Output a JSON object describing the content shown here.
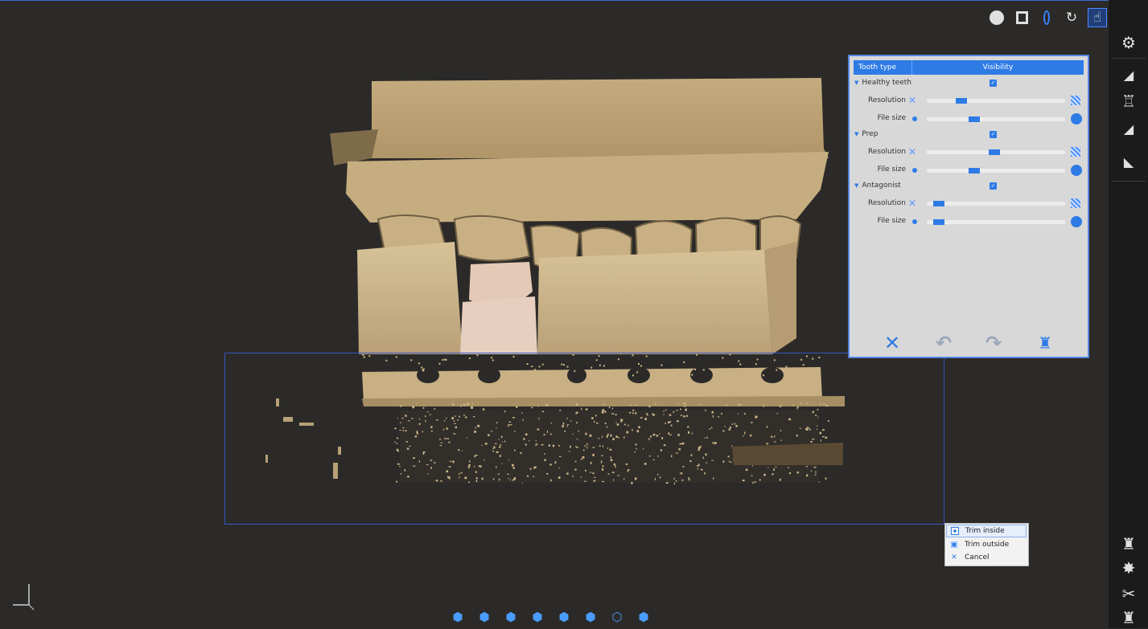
{
  "toolbar": {
    "icons": [
      "disc-icon",
      "save-icon",
      "oval-selection-icon",
      "rotate-icon",
      "hand-icon"
    ],
    "window_controls": [
      "minimize",
      "restore",
      "close"
    ]
  },
  "sidebar": {
    "top_icons": [
      "settings-icon",
      "scan-base-icon",
      "tooth-model-icon",
      "scan-bite-icon",
      "scan-arch-icon"
    ],
    "bottom_icons": [
      "tooth-icon",
      "tooth-light-icon",
      "scissors-icon",
      "tooth-alt-icon"
    ]
  },
  "panel": {
    "col_tooth_type": "Tooth type",
    "col_visibility": "Visibility",
    "groups": [
      {
        "name": "Healthy teeth",
        "visible": true,
        "resolution_level": 0.23,
        "file_size_level": 0.33
      },
      {
        "name": "Prep",
        "visible": true,
        "resolution_level": 0.49,
        "file_size_level": 0.33
      },
      {
        "name": "Antagonist",
        "visible": true,
        "resolution_level": 0.05,
        "file_size_level": 0.05
      }
    ],
    "resolution_label": "Resolution",
    "file_size_label": "File size",
    "buttons": [
      "cancel",
      "undo",
      "redo",
      "tooth-light"
    ]
  },
  "context_menu": {
    "items": [
      {
        "label": "Trim inside",
        "icon": "trim-inside-icon",
        "highlighted": true
      },
      {
        "label": "Trim outside",
        "icon": "trim-outside-icon",
        "highlighted": false
      },
      {
        "label": "Cancel",
        "icon": "cancel-icon",
        "highlighted": false
      }
    ]
  },
  "view_icons": [
    "view-front",
    "view-back",
    "view-left",
    "view-right",
    "view-top",
    "view-bottom",
    "view-iso",
    "view-reset"
  ],
  "colors": {
    "accent": "#2e7be6",
    "model": "#c9b183",
    "background": "#2b2a28"
  }
}
